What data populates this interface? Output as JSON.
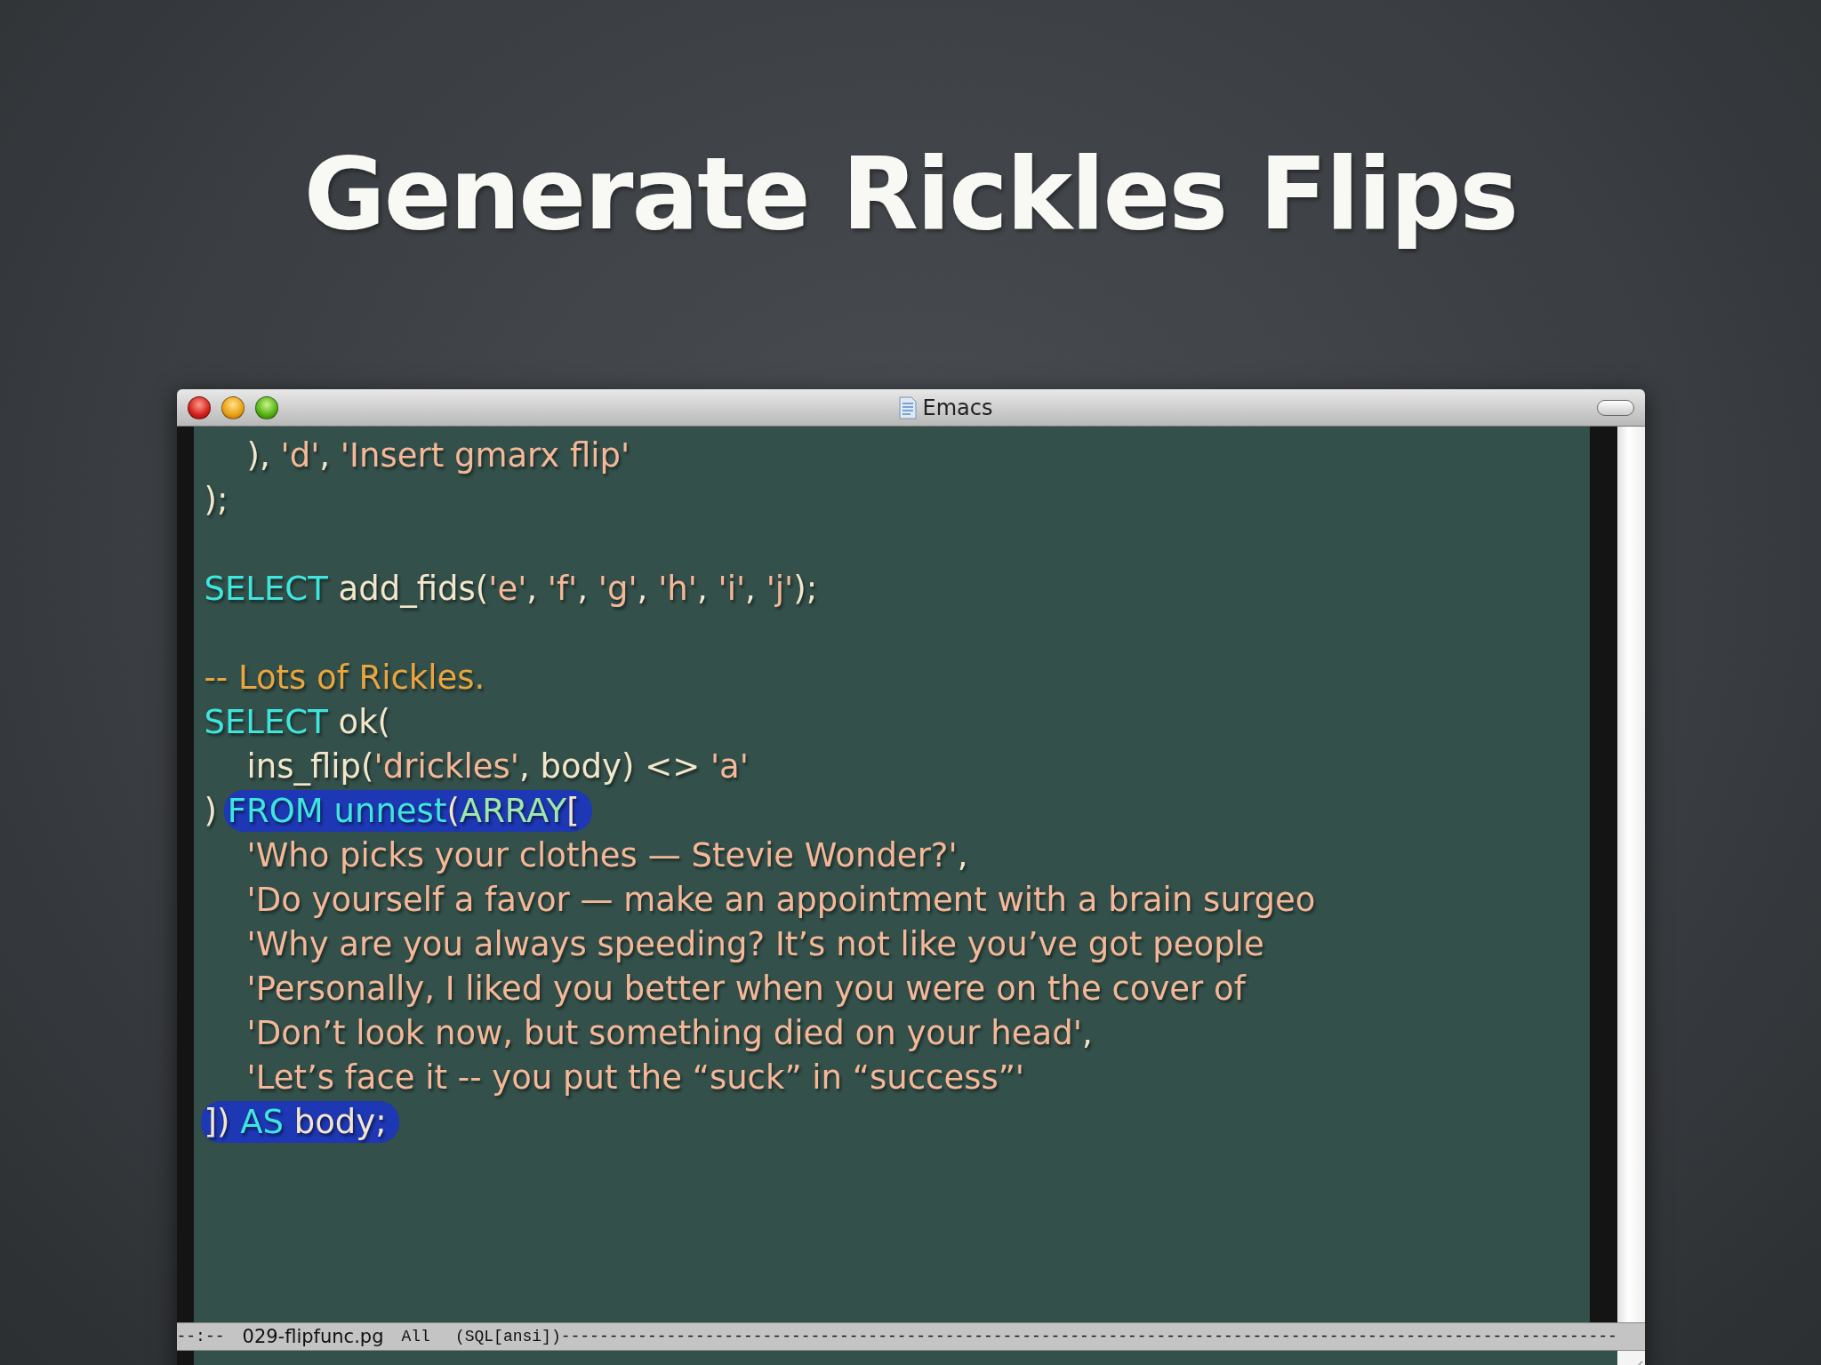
{
  "slide": {
    "title": "Generate Rickles Flips"
  },
  "window": {
    "title": "Emacs"
  },
  "editor": {
    "lines": [
      {
        "kind": "code",
        "indented": true,
        "segments": [
          {
            "kind": "plain",
            "text": "), ",
            "marked": false
          },
          {
            "kind": "string",
            "text": "'d'",
            "marked": false
          },
          {
            "kind": "plain",
            "text": ", ",
            "marked": false
          },
          {
            "kind": "string",
            "text": "'Insert gmarx flip'",
            "marked": false
          }
        ]
      },
      {
        "kind": "code",
        "indented": false,
        "segments": [
          {
            "kind": "plain",
            "text": ");",
            "marked": false
          }
        ]
      },
      {
        "kind": "blank"
      },
      {
        "kind": "code",
        "indented": false,
        "segments": [
          {
            "kind": "keyword",
            "text": "SELECT",
            "marked": false
          },
          {
            "kind": "plain",
            "text": " add_fids(",
            "marked": false
          },
          {
            "kind": "string",
            "text": "'e'",
            "marked": false
          },
          {
            "kind": "plain",
            "text": ", ",
            "marked": false
          },
          {
            "kind": "string",
            "text": "'f'",
            "marked": false
          },
          {
            "kind": "plain",
            "text": ", ",
            "marked": false
          },
          {
            "kind": "string",
            "text": "'g'",
            "marked": false
          },
          {
            "kind": "plain",
            "text": ", ",
            "marked": false
          },
          {
            "kind": "string",
            "text": "'h'",
            "marked": false
          },
          {
            "kind": "plain",
            "text": ", ",
            "marked": false
          },
          {
            "kind": "string",
            "text": "'i'",
            "marked": false
          },
          {
            "kind": "plain",
            "text": ", ",
            "marked": false
          },
          {
            "kind": "string",
            "text": "'j'",
            "marked": false
          },
          {
            "kind": "plain",
            "text": ");",
            "marked": false
          }
        ]
      },
      {
        "kind": "blank"
      },
      {
        "kind": "code",
        "indented": false,
        "segments": [
          {
            "kind": "comment",
            "text": "-- Lots of Rickles.",
            "marked": false
          }
        ]
      },
      {
        "kind": "code",
        "indented": false,
        "segments": [
          {
            "kind": "keyword",
            "text": "SELECT",
            "marked": false
          },
          {
            "kind": "plain",
            "text": " ok(",
            "marked": false
          }
        ]
      },
      {
        "kind": "code",
        "indented": true,
        "segments": [
          {
            "kind": "plain",
            "text": "ins_flip(",
            "marked": false
          },
          {
            "kind": "string",
            "text": "'drickles'",
            "marked": false
          },
          {
            "kind": "plain",
            "text": ", body) <> ",
            "marked": false
          },
          {
            "kind": "string",
            "text": "'a'",
            "marked": false
          }
        ]
      },
      {
        "kind": "code",
        "indented": false,
        "segments": [
          {
            "kind": "plain",
            "text": ") ",
            "marked": false
          },
          {
            "kind": "keyword",
            "text": "FROM unnest",
            "marked": true
          },
          {
            "kind": "plain",
            "text": "(",
            "marked": true
          },
          {
            "kind": "type",
            "text": "ARRAY",
            "marked": true
          },
          {
            "kind": "plain",
            "text": "[",
            "marked": true
          }
        ]
      },
      {
        "kind": "code",
        "indented": true,
        "segments": [
          {
            "kind": "string",
            "text": "'Who picks your clothes — Stevie Wonder?'",
            "marked": false
          },
          {
            "kind": "plain",
            "text": ",",
            "marked": false
          }
        ]
      },
      {
        "kind": "code",
        "indented": true,
        "segments": [
          {
            "kind": "string",
            "text": "'Do yourself a favor — make an appointment with a brain surgeo",
            "marked": false
          }
        ]
      },
      {
        "kind": "code",
        "indented": true,
        "segments": [
          {
            "kind": "string",
            "text": "'Why are you always speeding? It’s not like you’ve got people",
            "marked": false
          }
        ]
      },
      {
        "kind": "code",
        "indented": true,
        "segments": [
          {
            "kind": "string",
            "text": "'Personally, I liked you better when you were on the cover of",
            "marked": false
          }
        ]
      },
      {
        "kind": "code",
        "indented": true,
        "segments": [
          {
            "kind": "string",
            "text": "'Don’t look now, but something died on your head'",
            "marked": false
          },
          {
            "kind": "plain",
            "text": ",",
            "marked": false
          }
        ]
      },
      {
        "kind": "code",
        "indented": true,
        "segments": [
          {
            "kind": "string",
            "text": "'Let’s face it -- you put the “suck” in “success”'",
            "marked": false
          }
        ]
      },
      {
        "kind": "code",
        "indented": false,
        "segments": [
          {
            "kind": "plain",
            "text": "]) ",
            "marked": true
          },
          {
            "kind": "keyword",
            "text": "AS",
            "marked": true
          },
          {
            "kind": "plain",
            "text": " body;",
            "marked": true
          }
        ]
      }
    ]
  },
  "mode_line": {
    "status": "--:--",
    "buffer": "029-flipfunc.pg",
    "position": "All",
    "mode": "(SQL[ansi])",
    "fill": "--------------------------------------------------------------------------------------------------------------"
  }
}
